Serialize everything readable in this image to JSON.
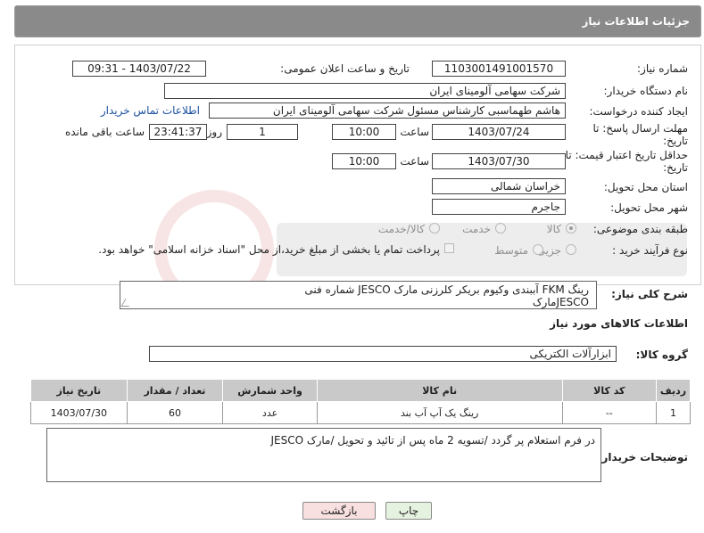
{
  "header": {
    "title": "جزئیات اطلاعات نیاز"
  },
  "form": {
    "need_number_label": "شماره نیاز:",
    "need_number": "1103001491001570",
    "announce_label": "تاریخ و ساعت اعلان عمومی:",
    "announce_value": "1403/07/22 - 09:31",
    "buyer_label": "نام دستگاه خریدار:",
    "buyer_value": "شرکت سهامی آلومینای ایران",
    "creator_label": "ایجاد کننده درخواست:",
    "creator_value": "هاشم طهماسبی کارشناس مسئول شرکت سهامی آلومینای ایران",
    "contact_link": "اطلاعات تماس خریدار",
    "deadline_label_1": "مهلت ارسال پاسخ: تا",
    "deadline_label_2": "تاریخ:",
    "deadline_date": "1403/07/24",
    "time_label": "ساعت",
    "deadline_time": "10:00",
    "days_value": "1",
    "days_label": "روز و",
    "remaining_time": "23:41:37",
    "remaining_label": "ساعت باقی مانده",
    "price_label_1": "حداقل تاریخ اعتبار قیمت: تا",
    "price_label_2": "تاریخ:",
    "price_date": "1403/07/30",
    "price_time": "10:00",
    "province_label": "استان محل تحویل:",
    "province_value": "خراسان شمالی",
    "city_label": "شهر محل تحویل:",
    "city_value": "جاجرم",
    "category_label": "طبقه بندی موضوعی:",
    "category_options": [
      "کالا",
      "خدمت",
      "کالا/خدمت"
    ],
    "process_label": "نوع فرآیند خرید :",
    "process_options": [
      "جزیی",
      "متوسط"
    ],
    "treasury_note": "پرداخت تمام یا بخشی از مبلغ خرید،از محل \"اسناد خزانه اسلامی\" خواهد بود."
  },
  "description": {
    "label": "شرح کلی نیاز:",
    "text_line1": "رینگ FKM آببندی وکیوم بریکر کلرزنی مارک JESCO شماره فنی",
    "text_line2": "JESCOمارک"
  },
  "goods_section_title": "اطلاعات کالاهای مورد نیاز",
  "goods_group": {
    "label": "گروه کالا:",
    "value": "ابزارآلات الکتریکی"
  },
  "table": {
    "headers": [
      "ردیف",
      "کد کالا",
      "نام کالا",
      "واحد شمارش",
      "تعداد / مقدار",
      "تاریخ نیاز"
    ],
    "rows": [
      [
        "1",
        "--",
        "رینگ یک آپ آب بند",
        "عدد",
        "60",
        "1403/07/30"
      ]
    ]
  },
  "buyer_notes": {
    "label": "توضیحات خریدار:",
    "text": "در فرم استعلام پر گردد /تسویه 2 ماه پس از تائید و تحویل /مارک JESCO"
  },
  "buttons": {
    "print": "چاپ",
    "back": "بازگشت"
  },
  "colors": {
    "header_bg": "#8a8a8a",
    "table_header_bg": "#c9c9c9",
    "link": "#1a4fa0",
    "back_btn_bg": "#f8e0e0",
    "print_btn_bg": "#e6f2e0"
  }
}
